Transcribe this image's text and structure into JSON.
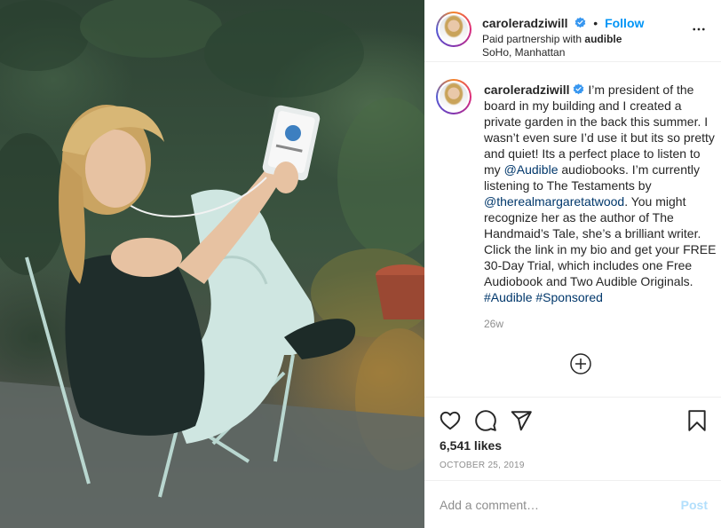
{
  "post": {
    "image_alt": "Woman seated on a garden chair holding a phone with earphones"
  },
  "header": {
    "username": "caroleradziwill",
    "dot": "•",
    "follow_label": "Follow",
    "partnership_prefix": "Paid partnership with ",
    "partner": "audible",
    "location": "SoHo, Manhattan",
    "more_icon": "more-options-icon"
  },
  "caption": {
    "username": "caroleradziwill",
    "text_1": " I’m president of the board in my building and I created a private garden in the back this summer. I wasn’t even sure I’d use it but its so pretty and quiet! Its a perfect place to listen to my ",
    "mention_1": "@Audible",
    "text_2": " audiobooks. I’m currently listening to The Testaments by ",
    "mention_2": "@therealmargaretatwood",
    "text_3": ". You might recognize her as the author of The Handmaid’s Tale, she’s a brilliant writer. Click the link in my bio and get your FREE 30-Day Trial, which includes one Free Audiobook and Two Audible Originals. ",
    "hashtag_1": "#Audible",
    "space": " ",
    "hashtag_2": "#Sponsored",
    "time_ago": "26w"
  },
  "actions": {
    "likes": "6,541 likes",
    "date": "OCTOBER 25, 2019"
  },
  "comment": {
    "placeholder": "Add a comment…",
    "post_label": "Post"
  },
  "colors": {
    "link": "#00376b",
    "follow": "#0095f6",
    "post_disabled": "#b2dffc",
    "verified": "#3897f0"
  }
}
